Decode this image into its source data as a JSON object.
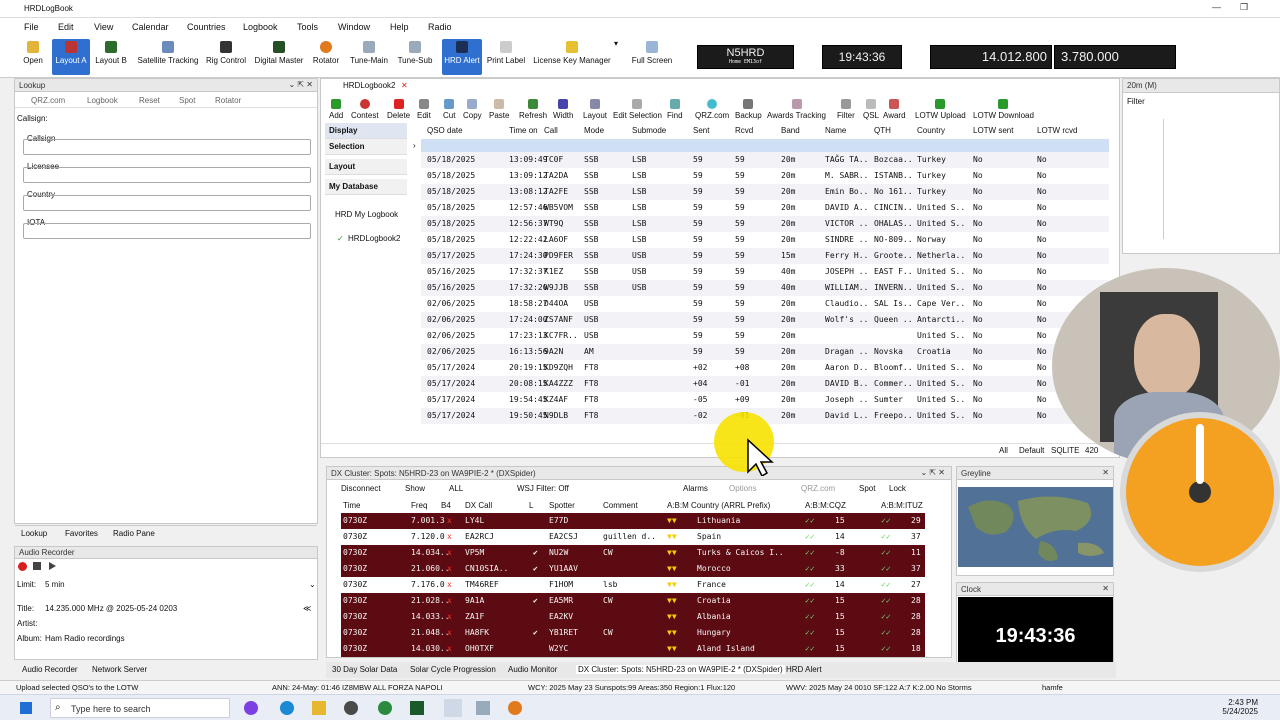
{
  "window": {
    "title": "HRDLogBook"
  },
  "menu": [
    "File",
    "Edit",
    "View",
    "Calendar",
    "Countries",
    "Logbook",
    "Tools",
    "Window",
    "Help",
    "Radio"
  ],
  "toolbar": {
    "items": [
      "Open",
      "Layout A",
      "Layout B",
      "Satellite Tracking",
      "Rig Control",
      "Digital Master",
      "Rotator",
      "Tune-Main",
      "Tune-Sub",
      "HRD Alert",
      "Print Label",
      "License Key Manager",
      "Full Screen"
    ]
  },
  "displays": {
    "callsign": "N5HRD",
    "callsign_sub": "Home EM13of",
    "time": "19:43:36",
    "freq_main": "14.012.800",
    "freq_sub": "3.780.000"
  },
  "lookup": {
    "title": "Lookup",
    "tools": [
      "QRZ.com",
      "Logbook",
      "Reset",
      "Spot",
      "Rotator"
    ],
    "callsign_label": "Callsign:",
    "fields": [
      "Callsign",
      "Licensee",
      "Country",
      "IOTA"
    ],
    "tabs": [
      "Lookup",
      "Favorites",
      "Radio Pane"
    ]
  },
  "audio": {
    "title": "Audio Recorder",
    "limit_label": "Limit:",
    "limit_value": "5 min",
    "title_label": "Title:",
    "title_value": "14.235.000 MHz @ 2025-05-24 0203",
    "artist_label": "Artist:",
    "album_label": "Album:",
    "album_value": "Ham Radio recordings",
    "tabs": [
      "Audio Recorder",
      "Network Server"
    ]
  },
  "logbook": {
    "tab": "HRDLogbook2",
    "tools": [
      "Add",
      "Contest",
      "Delete",
      "Edit",
      "Cut",
      "Copy",
      "Paste",
      "Refresh",
      "Width",
      "Layout",
      "Edit Selection",
      "Find",
      "QRZ.com",
      "Backup",
      "Awards Tracking",
      "Filter",
      "QSL",
      "Award",
      "LOTW Upload",
      "LOTW Download"
    ],
    "nav": [
      "Display",
      "Selection",
      "Layout",
      "My Database"
    ],
    "tree": [
      "HRD My Logbook",
      "HRDLogbook2"
    ],
    "columns": [
      "QSO date",
      "Time on",
      "Call",
      "Mode",
      "Submode",
      "Sent",
      "Rcvd",
      "Band",
      "Name",
      "QTH",
      "Country",
      "LOTW sent",
      "LOTW rcvd"
    ],
    "rows": [
      [
        "05/18/2025",
        "13:09:49",
        "TC0F",
        "SSB",
        "LSB",
        "59",
        "59",
        "20m",
        "TAĞG TA..",
        "Bozcaa..",
        "Turkey",
        "No",
        "No"
      ],
      [
        "05/18/2025",
        "13:09:12",
        "TA2DA",
        "SSB",
        "LSB",
        "59",
        "59",
        "20m",
        "M. SABR..",
        "ISTANB..",
        "Turkey",
        "No",
        "No"
      ],
      [
        "05/18/2025",
        "13:08:12",
        "TA2FE",
        "SSB",
        "LSB",
        "59",
        "59",
        "20m",
        "Emin Bo..",
        "No 161..",
        "Turkey",
        "No",
        "No"
      ],
      [
        "05/18/2025",
        "12:57:46",
        "WB5VOM",
        "SSB",
        "LSB",
        "59",
        "59",
        "20m",
        "DAVID A..",
        "CINCIN..",
        "United S..",
        "No",
        "No"
      ],
      [
        "05/18/2025",
        "12:56:37",
        "WT9Q",
        "SSB",
        "LSB",
        "59",
        "59",
        "20m",
        "VICTOR ..",
        "OHALAS..",
        "United S..",
        "No",
        "No"
      ],
      [
        "05/18/2025",
        "12:22:42",
        "LA6OF",
        "SSB",
        "LSB",
        "59",
        "59",
        "20m",
        "SINDRE ..",
        "NO-809..",
        "Norway",
        "No",
        "No"
      ],
      [
        "05/17/2025",
        "17:24:30",
        "PD9FER",
        "SSB",
        "USB",
        "59",
        "59",
        "15m",
        "Ferry H..",
        "Groote..",
        "Netherla..",
        "No",
        "No"
      ],
      [
        "05/16/2025",
        "17:32:37",
        "K1EZ",
        "SSB",
        "USB",
        "59",
        "59",
        "40m",
        "JOSEPH ..",
        "EAST F..",
        "United S..",
        "No",
        "No"
      ],
      [
        "05/16/2025",
        "17:32:20",
        "W9JJB",
        "SSB",
        "USB",
        "59",
        "59",
        "40m",
        "WILLIAM..",
        "INVERN..",
        "United S..",
        "No",
        "No"
      ],
      [
        "02/06/2025",
        "18:58:27",
        "D44OA",
        "USB",
        "",
        "59",
        "59",
        "20m",
        "Claudio..",
        "SAL Is..",
        "Cape Ver..",
        "No",
        "No"
      ],
      [
        "02/06/2025",
        "17:24:00",
        "ZS7ANF",
        "USB",
        "",
        "59",
        "59",
        "20m",
        "Wolf's ..",
        "Queen ..",
        "Antarcti..",
        "No",
        "No"
      ],
      [
        "02/06/2025",
        "17:23:13",
        "KC7FR..",
        "USB",
        "",
        "59",
        "59",
        "20m",
        "",
        "",
        "United S..",
        "No",
        "No"
      ],
      [
        "02/06/2025",
        "16:13:56",
        "9A2N",
        "AM",
        "",
        "59",
        "59",
        "20m",
        "Dragan ..",
        "Novska",
        "Croatia",
        "No",
        "No"
      ],
      [
        "05/17/2024",
        "20:19:15",
        "KD9ZQH",
        "FT8",
        "",
        "+02",
        "+08",
        "20m",
        "Aaron D..",
        "Bloomf..",
        "United S..",
        "No",
        "No"
      ],
      [
        "05/17/2024",
        "20:08:15",
        "KA4ZZZ",
        "FT8",
        "",
        "+04",
        "-01",
        "20m",
        "DAVID B..",
        "Commer..",
        "United S..",
        "No",
        "No"
      ],
      [
        "05/17/2024",
        "19:54:45",
        "KZ4AF",
        "FT8",
        "",
        "-05",
        "+09",
        "20m",
        "Joseph ..",
        "Sumter",
        "United S..",
        "No",
        "No"
      ],
      [
        "05/17/2024",
        "19:50:45",
        "N9DLB",
        "FT8",
        "",
        "-02",
        "-01",
        "20m",
        "David L..",
        "Freepo..",
        "United S..",
        "No",
        "No"
      ]
    ],
    "status": [
      "All",
      "Default",
      "SQLITE",
      "420"
    ]
  },
  "cluster": {
    "title": "DX Cluster: Spots: N5HRD-23 on WA9PIE-2 * (DXSpider)",
    "tools": [
      "Disconnect",
      "Show",
      "ALL",
      "WSJ Filter: Off",
      "Alarms",
      "Options",
      "QRZ.com",
      "Spot",
      "Lock"
    ],
    "columns": [
      "Time",
      "Freq",
      "B4",
      "DX Call",
      "L",
      "Spotter",
      "Comment",
      "A:B:M Country (ARRL Prefix)",
      "A:B:M:CQZ",
      "A:B:M:ITUZ"
    ],
    "rows": [
      {
        "time": "0730Z",
        "freq": "7.001.3",
        "b4": "x",
        "call": "LY4L",
        "l": "",
        "spotter": "E77D",
        "comment": "",
        "country": "Lithuania",
        "cqz": "15",
        "ituz": "29",
        "dark": true
      },
      {
        "time": "0730Z",
        "freq": "7.120.0",
        "b4": "x",
        "call": "EA2RCJ",
        "l": "",
        "spotter": "EA2CSJ",
        "comment": "guillen d..",
        "country": "Spain",
        "cqz": "14",
        "ituz": "37",
        "dark": false
      },
      {
        "time": "0730Z",
        "freq": "14.034..",
        "b4": "x",
        "call": "VP5M",
        "l": "✔",
        "spotter": "NU2W",
        "comment": "CW",
        "country": "Turks & Caicos I..",
        "cqz": "-8",
        "ituz": "11",
        "dark": true
      },
      {
        "time": "0730Z",
        "freq": "21.060..",
        "b4": "x",
        "call": "CN10SIA..",
        "l": "✔",
        "spotter": "YU1AAV",
        "comment": "",
        "country": "Morocco",
        "cqz": "33",
        "ituz": "37",
        "dark": true
      },
      {
        "time": "0730Z",
        "freq": "7.176.0",
        "b4": "x",
        "call": "TM46REF",
        "l": "",
        "spotter": "F1HOM",
        "comment": "lsb",
        "country": "France",
        "cqz": "14",
        "ituz": "27",
        "dark": false
      },
      {
        "time": "0730Z",
        "freq": "21.028..",
        "b4": "x",
        "call": "9A1A",
        "l": "✔",
        "spotter": "EA5MR",
        "comment": "CW",
        "country": "Croatia",
        "cqz": "15",
        "ituz": "28",
        "dark": true
      },
      {
        "time": "0730Z",
        "freq": "14.033..",
        "b4": "x",
        "call": "ZA1F",
        "l": "",
        "spotter": "EA2KV",
        "comment": "",
        "country": "Albania",
        "cqz": "15",
        "ituz": "28",
        "dark": true
      },
      {
        "time": "0730Z",
        "freq": "21.048..",
        "b4": "x",
        "call": "HA8FK",
        "l": "✔",
        "spotter": "YB1RET",
        "comment": "CW",
        "country": "Hungary",
        "cqz": "15",
        "ituz": "28",
        "dark": true
      },
      {
        "time": "0730Z",
        "freq": "14.030..",
        "b4": "x",
        "call": "OH0TXF",
        "l": "",
        "spotter": "W2YC",
        "comment": "",
        "country": "Aland Island",
        "cqz": "15",
        "ituz": "18",
        "dark": true
      }
    ]
  },
  "bandmap": {
    "title": "20m (M)",
    "filter": "Filter"
  },
  "greyline": {
    "title": "Greyline"
  },
  "clock": {
    "title": "Clock",
    "time": "19:43:36"
  },
  "bottomtabs": [
    "30 Day Solar Data",
    "Solar Cycle Progression",
    "Audio Monitor",
    "DX Cluster: Spots: N5HRD-23 on WA9PIE-2 * (DXSpider)",
    "HRD Alert"
  ],
  "statusbar": {
    "left": "Upload selected QSO's to the LOTW",
    "ann": "ANN: 24-May: 01:46 IZ8MBW ALL FORZA NAPOLI",
    "wcy": "WCY: 2025 May 23 Sunspots:99 Areas:350 Region:1 Flux:120",
    "wwv": "WWV: 2025 May 24 0010 SF:122 A:7 K:2.00 No Storms",
    "user": "hamfe"
  },
  "taskbar": {
    "search_placeholder": "Type here to search",
    "time": "2:43 PM",
    "date": "5/24/2025"
  },
  "colors": {
    "accent": "#2f6fd0",
    "cluster_dark": "#5c0b12",
    "dial": "#f4a020"
  }
}
